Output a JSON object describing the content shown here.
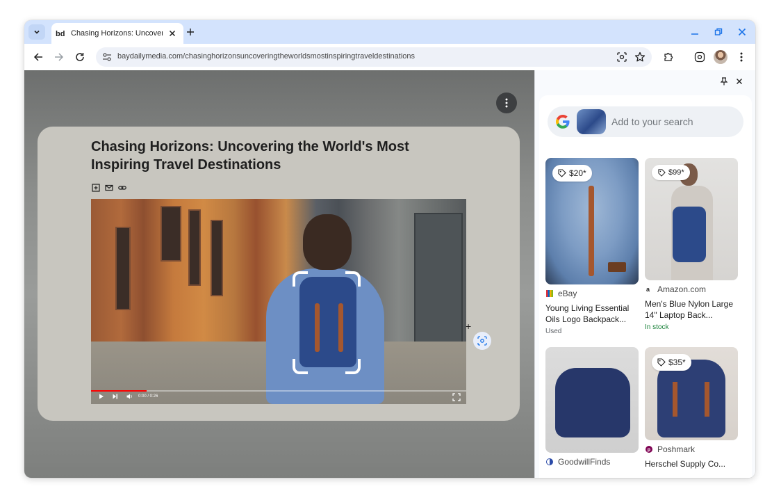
{
  "browser": {
    "tab_title": "Chasing Horizons: Uncovering the World's Most Inspiring Travel Destinations",
    "url": "baydailymedia.com/chasinghorizonsuncoveringtheworldsmostinspiringtraveldestinations"
  },
  "article": {
    "title": "Chasing Horizons: Uncovering the World's Most Inspiring Travel Destinations",
    "video_time": "0:00 / 0:26"
  },
  "panel": {
    "search_placeholder": "Add to your search",
    "results": [
      {
        "price": "$20*",
        "source": "eBay",
        "name": "Young Living Essential Oils Logo Backpack...",
        "stock": "Used"
      },
      {
        "price": "$99*",
        "source": "Amazon.com",
        "name": "Men's Blue Nylon Large 14\" Laptop Back...",
        "stock": "In stock"
      },
      {
        "price": "",
        "source": "GoodwillFinds",
        "name": "",
        "stock": ""
      },
      {
        "price": "$35*",
        "source": "Poshmark",
        "name": "Herschel Supply Co...",
        "stock": ""
      }
    ]
  },
  "colors": {
    "tabstrip": "#d3e3fd",
    "accent": "#1a73e8",
    "in_stock": "#188038"
  }
}
